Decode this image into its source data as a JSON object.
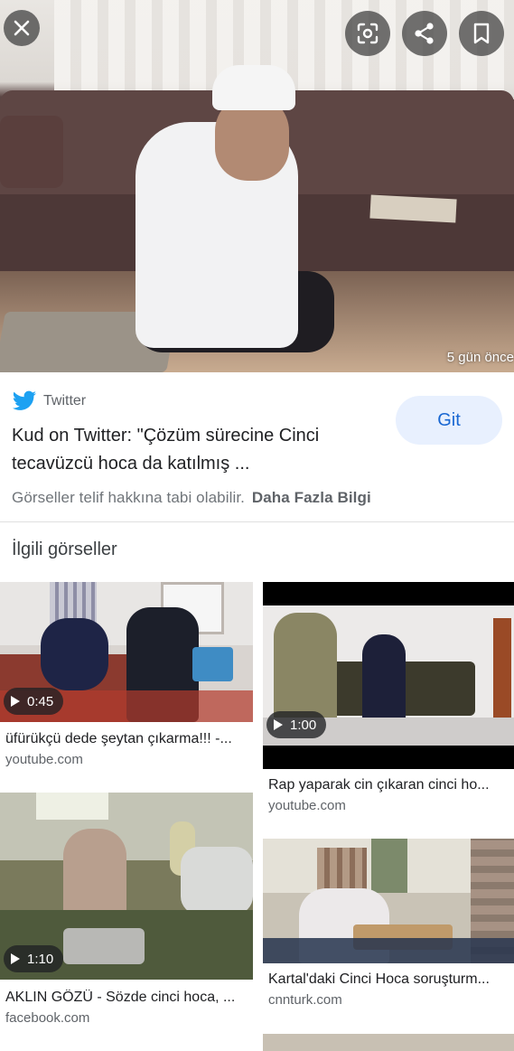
{
  "hero": {
    "timestamp": "5 gün önce",
    "close_icon": "close-icon",
    "lens_icon": "google-lens-icon",
    "share_icon": "share-icon",
    "save_icon": "bookmark-icon"
  },
  "result": {
    "source_name": "Twitter",
    "source_icon": "twitter-bird-icon",
    "title": "Kud on Twitter: \"Çözüm sürecine Cinci tecavüzcü hoca da katılmış ...",
    "go_label": "Git",
    "copyright_text": "Görseller telif hakkına tabi olabilir.",
    "more_info_label": "Daha Fazla Bilgi"
  },
  "related": {
    "heading": "İlgili görseller",
    "left": [
      {
        "duration": "0:45",
        "title": "üfürükçü dede şeytan çıkarma!!! -...",
        "domain": "youtube.com"
      },
      {
        "duration": "1:10",
        "title": "AKLIN GÖZÜ - Sözde cinci hoca, ...",
        "domain": "facebook.com"
      }
    ],
    "right": [
      {
        "duration": "1:00",
        "title": "Rap yaparak cin çıkaran cinci ho...",
        "domain": "youtube.com"
      },
      {
        "duration": "",
        "title": "Kartal'daki Cinci Hoca soruşturm...",
        "domain": "cnnturk.com"
      }
    ]
  },
  "colors": {
    "accent": "#1a73e8",
    "twitter_blue": "#1da1f2",
    "go_button_bg": "#e8f0fe"
  }
}
